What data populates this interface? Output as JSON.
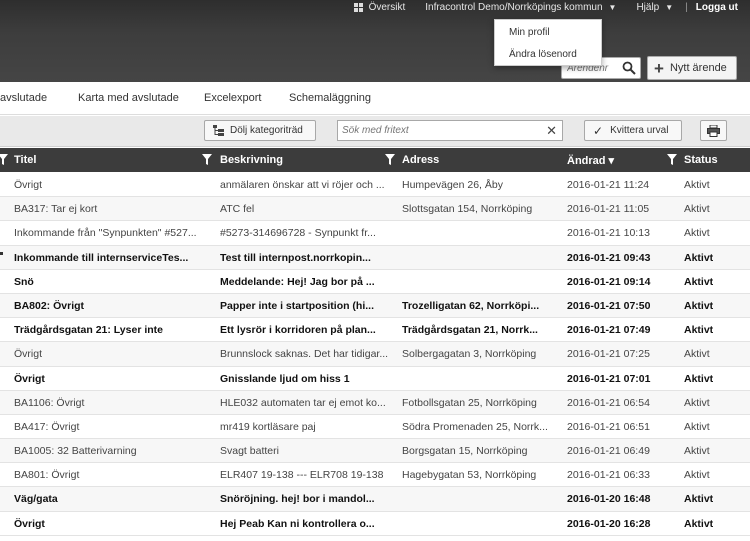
{
  "topnav": {
    "overview": "Översikt",
    "org": "Infracontrol Demo/Norrköpings kommun",
    "help": "Hjälp",
    "logout": "Logga ut"
  },
  "profile_menu": {
    "items": [
      "Min profil",
      "Ändra lösenord"
    ]
  },
  "search": {
    "placeholder": "Ärendenr"
  },
  "new_case": {
    "label": "Nytt ärende"
  },
  "tabs": [
    "avslutade",
    "Karta med avslutade",
    "Excelexport",
    "Schemaläggning"
  ],
  "toolbar": {
    "hide_category_tree": "Dölj kategoriträd",
    "fritext_placeholder": "Sök med fritext",
    "acknowledge": "Kvittera urval"
  },
  "table": {
    "columns": {
      "title": "Titel",
      "description": "Beskrivning",
      "address": "Adress",
      "changed": "Ändrad ▾",
      "status": "Status"
    },
    "rows": [
      {
        "title": "Övrigt",
        "desc": "anmälaren önskar att vi röjer och ...",
        "addr": "Humpevägen 26, Åby",
        "changed": "2016-01-21 11:24",
        "status": "Aktivt",
        "unread": false
      },
      {
        "title": "BA317: Tar ej kort",
        "desc": "ATC fel",
        "addr": "Slottsgatan 154, Norrköping",
        "changed": "2016-01-21 11:05",
        "status": "Aktivt",
        "unread": false
      },
      {
        "title": "Inkommande från \"Synpunkten\" #527...",
        "desc": "#5273-314696728 - Synpunkt fr...",
        "addr": "",
        "changed": "2016-01-21 10:13",
        "status": "Aktivt",
        "unread": false
      },
      {
        "title": "Inkommande till internserviceTes...",
        "desc": "Test till internpost.norrkopin...",
        "addr": "",
        "changed": "2016-01-21 09:43",
        "status": "Aktivt",
        "unread": true
      },
      {
        "title": "Snö",
        "desc": "Meddelande: Hej! Jag bor på ...",
        "addr": "",
        "changed": "2016-01-21 09:14",
        "status": "Aktivt",
        "unread": true
      },
      {
        "title": "BA802: Övrigt",
        "desc": "Papper inte i startposition (hi...",
        "addr": "Trozelligatan 62, Norrköpi...",
        "changed": "2016-01-21 07:50",
        "status": "Aktivt",
        "unread": true
      },
      {
        "title": "Trädgårdsgatan 21: Lyser inte",
        "desc": "Ett lysrör i korridoren på plan...",
        "addr": "Trädgårdsgatan 21, Norrk...",
        "changed": "2016-01-21 07:49",
        "status": "Aktivt",
        "unread": true
      },
      {
        "title": "Övrigt",
        "desc": "Brunnslock saknas. Det har tidigar...",
        "addr": "Solbergagatan 3, Norrköping",
        "changed": "2016-01-21 07:25",
        "status": "Aktivt",
        "unread": false
      },
      {
        "title": "Övrigt",
        "desc": "Gnisslande ljud om hiss 1",
        "addr": "",
        "changed": "2016-01-21 07:01",
        "status": "Aktivt",
        "unread": true
      },
      {
        "title": "BA1106: Övrigt",
        "desc": "HLE032 automaten tar ej emot ko...",
        "addr": "Fotbollsgatan 25, Norrköping",
        "changed": "2016-01-21 06:54",
        "status": "Aktivt",
        "unread": false
      },
      {
        "title": "BA417: Övrigt",
        "desc": "mr419 kortläsare paj",
        "addr": "Södra Promenaden 25, Norrk...",
        "changed": "2016-01-21 06:51",
        "status": "Aktivt",
        "unread": false
      },
      {
        "title": "BA1005: 32 Batterivarning",
        "desc": "Svagt batteri",
        "addr": "Borgsgatan 15, Norrköping",
        "changed": "2016-01-21 06:49",
        "status": "Aktivt",
        "unread": false
      },
      {
        "title": "BA801: Övrigt",
        "desc": "ELR407 19-138 --- ELR708 19-138",
        "addr": "Hagebygatan 53, Norrköping",
        "changed": "2016-01-21 06:33",
        "status": "Aktivt",
        "unread": false
      },
      {
        "title": "Väg/gata",
        "desc": "Snöröjning. hej! bor i mandol...",
        "addr": "",
        "changed": "2016-01-20 16:48",
        "status": "Aktivt",
        "unread": true
      },
      {
        "title": "Övrigt",
        "desc": "Hej Peab Kan ni kontrollera o...",
        "addr": "",
        "changed": "2016-01-20 16:28",
        "status": "Aktivt",
        "unread": true
      }
    ]
  }
}
